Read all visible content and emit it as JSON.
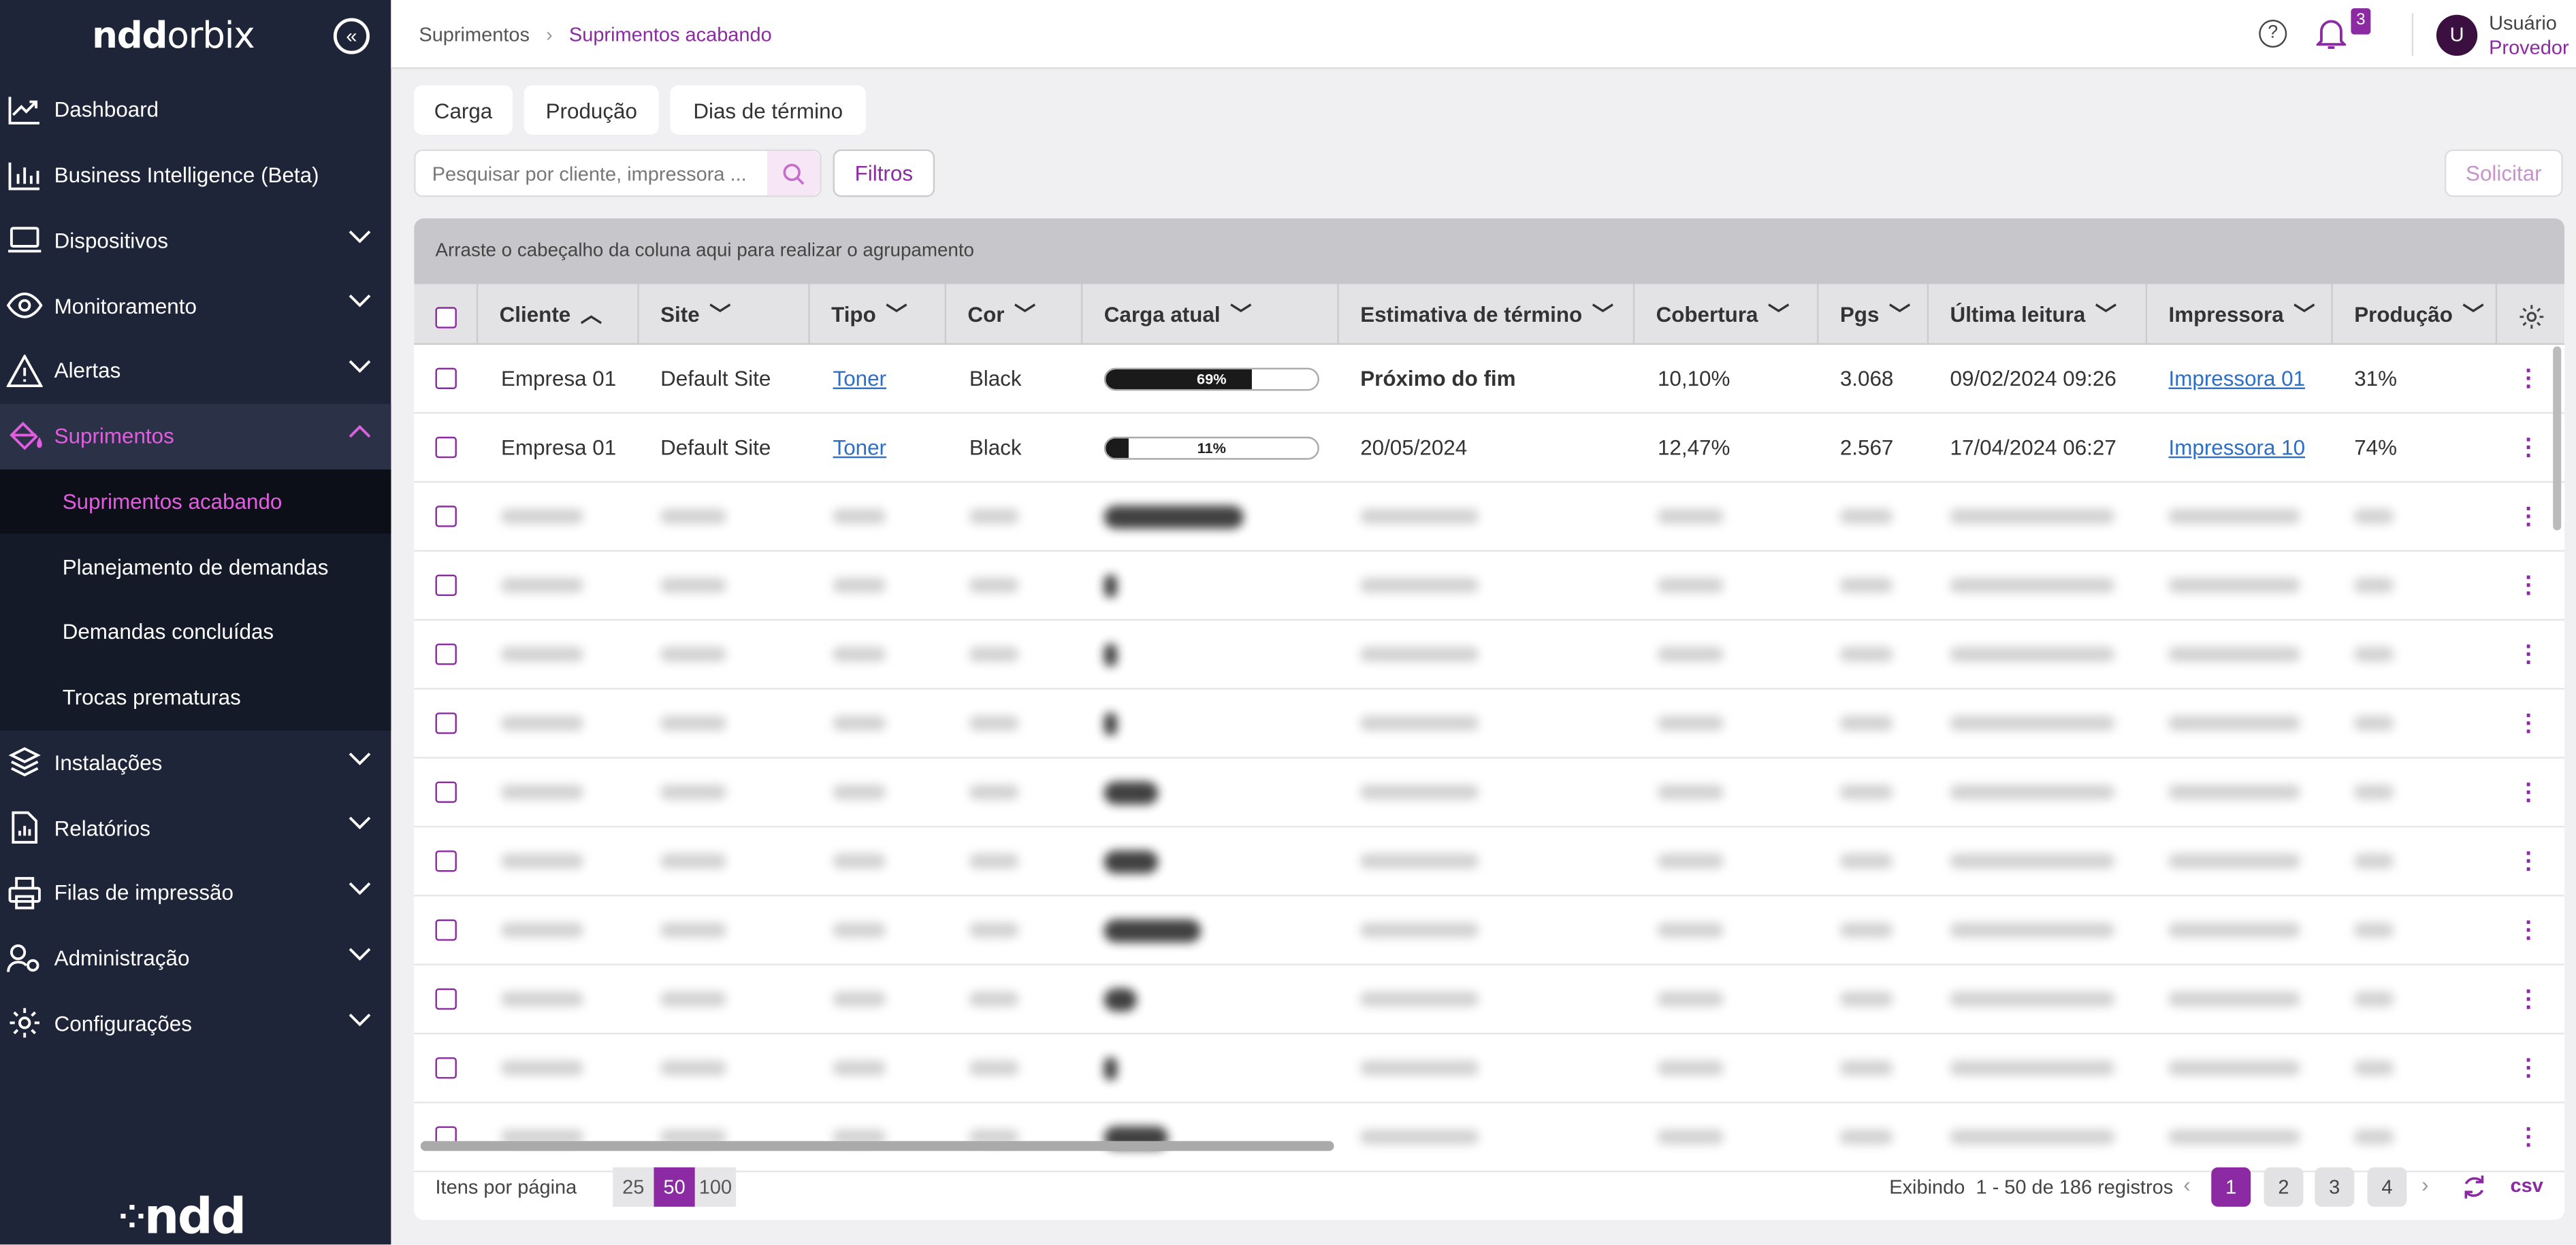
{
  "sidebar": {
    "logo": {
      "bold": "ndd",
      "light": "orbix"
    },
    "collapse_glyph": "«",
    "items": [
      {
        "label": "Dashboard",
        "icon": "trend-chart-icon",
        "expandable": false
      },
      {
        "label": "Business Intelligence (Beta)",
        "icon": "bar-chart-icon",
        "expandable": false
      },
      {
        "label": "Dispositivos",
        "icon": "laptop-icon",
        "expandable": true
      },
      {
        "label": "Monitoramento",
        "icon": "eye-icon",
        "expandable": true
      },
      {
        "label": "Alertas",
        "icon": "warning-icon",
        "expandable": true
      },
      {
        "label": "Suprimentos",
        "icon": "paint-bucket-icon",
        "expandable": true,
        "open": true
      }
    ],
    "subitems": [
      {
        "label": "Suprimentos acabando",
        "current": true
      },
      {
        "label": "Planejamento de demandas"
      },
      {
        "label": "Demandas concluídas"
      },
      {
        "label": "Trocas prematuras"
      }
    ],
    "items_after": [
      {
        "label": "Instalações",
        "icon": "layers-icon"
      },
      {
        "label": "Relatórios",
        "icon": "report-icon"
      },
      {
        "label": "Filas de impressão",
        "icon": "printer-icon"
      },
      {
        "label": "Administração",
        "icon": "users-gear-icon"
      },
      {
        "label": "Configurações",
        "icon": "gear-icon"
      }
    ],
    "brand": "ndd"
  },
  "header": {
    "breadcrumb": [
      "Suprimentos",
      "Suprimentos acabando"
    ],
    "help": "?",
    "notifications": "3",
    "user": {
      "initial": "U",
      "name": "Usuário",
      "role": "Provedor"
    }
  },
  "toolbar": {
    "tabs": [
      "Carga",
      "Produção",
      "Dias de término"
    ],
    "search_placeholder": "Pesquisar por cliente, impressora ...",
    "filters_label": "Filtros",
    "request_label": "Solicitar"
  },
  "grid": {
    "group_hint": "Arraste o cabeçalho da coluna aqui para realizar o agrupamento",
    "columns": [
      "Cliente",
      "Site",
      "Tipo",
      "Cor",
      "Carga atual",
      "Estimativa de término",
      "Cobertura",
      "Pgs",
      "Última leitura",
      "Impressora",
      "Produção"
    ],
    "rows": [
      {
        "cliente": "Empresa 01",
        "site": "Default Site",
        "tipo": "Toner",
        "cor": "Black",
        "carga": 69,
        "carga_label": "69%",
        "estimativa": "Próximo do fim",
        "est_bold": true,
        "cobertura": "10,10%",
        "pgs": "3.068",
        "leitura": "09/02/2024 09:26",
        "impressora": "Impressora 01",
        "producao": "31%"
      },
      {
        "cliente": "Empresa 01",
        "site": "Default Site",
        "tipo": "Toner",
        "cor": "Black",
        "carga": 11,
        "carga_label": "11%",
        "estimativa": "20/05/2024",
        "est_bold": false,
        "cobertura": "12,47%",
        "pgs": "2.567",
        "leitura": "17/04/2024 06:27",
        "impressora": "Impressora 10",
        "producao": "74%"
      }
    ]
  },
  "pager": {
    "per_page_label": "Itens por página",
    "sizes": [
      "25",
      "50",
      "100"
    ],
    "selected_size": "50",
    "summary": "Exibindo  1 - 50 de 186 registros",
    "pages": [
      "1",
      "2",
      "3",
      "4"
    ],
    "current_page": "1",
    "csv_label": "csv"
  },
  "colors": {
    "accent": "#8b2aa3",
    "sidebar": "#1f2538",
    "active_text": "#e35de1"
  }
}
